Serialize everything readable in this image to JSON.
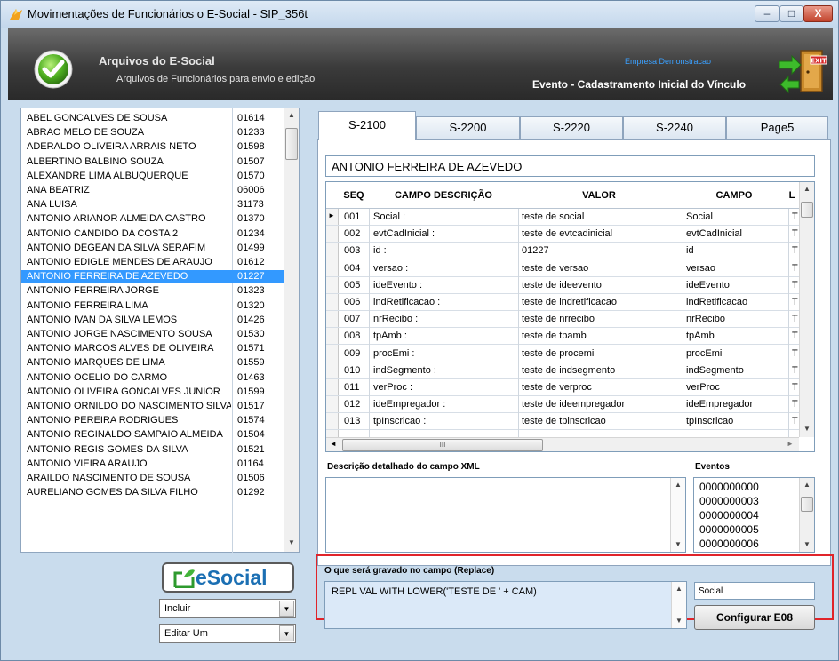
{
  "window": {
    "title": "Movimentações de Funcionários o E-Social - SIP_356t",
    "buttons": {
      "minimize": "–",
      "maximize": "□",
      "close": "X"
    }
  },
  "header": {
    "title": "Arquivos do E-Social",
    "subtitle": "Arquivos de Funcionários para envio e edição",
    "company": "Empresa Demonstracao",
    "event": "Evento - Cadastramento Inicial do Vínculo",
    "exit_label": "EXIT"
  },
  "employees": [
    {
      "name": "ABEL GONCALVES DE SOUSA",
      "code": "01614"
    },
    {
      "name": "ABRAO MELO DE SOUZA",
      "code": "01233"
    },
    {
      "name": "ADERALDO OLIVEIRA ARRAIS NETO",
      "code": "01598"
    },
    {
      "name": "ALBERTINO BALBINO SOUZA",
      "code": "01507"
    },
    {
      "name": "ALEXANDRE LIMA ALBUQUERQUE",
      "code": "01570"
    },
    {
      "name": "ANA BEATRIZ",
      "code": "06006"
    },
    {
      "name": "ANA LUISA",
      "code": "31173"
    },
    {
      "name": "ANTONIO ARIANOR ALMEIDA CASTRO",
      "code": "01370"
    },
    {
      "name": "ANTONIO CANDIDO DA COSTA 2",
      "code": "01234"
    },
    {
      "name": "ANTONIO DEGEAN DA SILVA SERAFIM",
      "code": "01499"
    },
    {
      "name": "ANTONIO EDIGLE MENDES DE ARAUJO",
      "code": "01612"
    },
    {
      "name": "ANTONIO FERREIRA DE AZEVEDO",
      "code": "01227"
    },
    {
      "name": "ANTONIO FERREIRA JORGE",
      "code": "01323"
    },
    {
      "name": "ANTONIO FERREIRA LIMA",
      "code": "01320"
    },
    {
      "name": "ANTONIO IVAN DA SILVA LEMOS",
      "code": "01426"
    },
    {
      "name": "ANTONIO JORGE NASCIMENTO SOUSA",
      "code": "01530"
    },
    {
      "name": "ANTONIO MARCOS ALVES DE OLIVEIRA",
      "code": "01571"
    },
    {
      "name": "ANTONIO MARQUES DE LIMA",
      "code": "01559"
    },
    {
      "name": "ANTONIO OCELIO DO CARMO",
      "code": "01463"
    },
    {
      "name": "ANTONIO OLIVEIRA GONCALVES JUNIOR",
      "code": "01599"
    },
    {
      "name": "ANTONIO ORNILDO DO NASCIMENTO SILVA",
      "code": "01517"
    },
    {
      "name": "ANTONIO PEREIRA RODRIGUES",
      "code": "01574"
    },
    {
      "name": "ANTONIO REGINALDO SAMPAIO ALMEIDA",
      "code": "01504"
    },
    {
      "name": "ANTONIO REGIS GOMES DA SILVA",
      "code": "01521"
    },
    {
      "name": "ANTONIO VIEIRA ARAUJO",
      "code": "01164"
    },
    {
      "name": "ARAILDO NASCIMENTO DE SOUSA",
      "code": "01506"
    },
    {
      "name": "AURELIANO GOMES DA SILVA FILHO",
      "code": "01292"
    }
  ],
  "selected_employee_index": 11,
  "logo": {
    "text": "eSocial"
  },
  "combos": {
    "action": "Incluir",
    "edit_mode": "Editar Um"
  },
  "tabs": [
    "S-2100",
    "S-2200",
    "S-2220",
    "S-2240",
    "Page5"
  ],
  "employee_name": "ANTONIO FERREIRA DE AZEVEDO",
  "grid": {
    "columns": [
      "SEQ",
      "CAMPO DESCRIÇÃO",
      "VALOR",
      "CAMPO",
      "L"
    ],
    "rows": [
      {
        "seq": "001",
        "desc": "Social :",
        "valor": "teste de social",
        "campo": "Social",
        "extra": "T"
      },
      {
        "seq": "002",
        "desc": "evtCadInicial :",
        "valor": "teste de evtcadinicial",
        "campo": "evtCadInicial",
        "extra": "T"
      },
      {
        "seq": "003",
        "desc": "id :",
        "valor": "01227",
        "campo": "id",
        "extra": "T"
      },
      {
        "seq": "004",
        "desc": "versao :",
        "valor": "teste de versao",
        "campo": "versao",
        "extra": "T"
      },
      {
        "seq": "005",
        "desc": "ideEvento :",
        "valor": "teste de ideevento",
        "campo": "ideEvento",
        "extra": "T"
      },
      {
        "seq": "006",
        "desc": "indRetificacao :",
        "valor": "teste de indretificacao",
        "campo": "indRetificacao",
        "extra": "T"
      },
      {
        "seq": "007",
        "desc": "nrRecibo :",
        "valor": "teste de nrrecibo",
        "campo": "nrRecibo",
        "extra": "T"
      },
      {
        "seq": "008",
        "desc": "tpAmb :",
        "valor": "teste de tpamb",
        "campo": "tpAmb",
        "extra": "T"
      },
      {
        "seq": "009",
        "desc": "procEmi :",
        "valor": "teste de procemi",
        "campo": "procEmi",
        "extra": "T"
      },
      {
        "seq": "010",
        "desc": "indSegmento :",
        "valor": "teste de indsegmento",
        "campo": "indSegmento",
        "extra": "T"
      },
      {
        "seq": "011",
        "desc": "verProc :",
        "valor": "teste de verproc",
        "campo": "verProc",
        "extra": "T"
      },
      {
        "seq": "012",
        "desc": "ideEmpregador :",
        "valor": "teste de ideempregador",
        "campo": "ideEmpregador",
        "extra": "T"
      },
      {
        "seq": "013",
        "desc": "tpInscricao :",
        "valor": "teste de tpinscricao",
        "campo": "tpInscricao",
        "extra": "T"
      }
    ]
  },
  "descricao_label": "Descrição detalhado do campo XML",
  "eventos": {
    "label": "Eventos",
    "items": [
      "0000000000",
      "0000000003",
      "0000000004",
      "0000000005",
      "0000000006"
    ]
  },
  "replace": {
    "label": "O que será gravado no campo (Replace)",
    "value": "REPL VAL WITH LOWER('TESTE DE ' + CAM)"
  },
  "campo_field": "Social",
  "config_button": "Configurar E08",
  "colors": {
    "selection": "#3399ff",
    "highlight": "#e0242a",
    "header_bg": "#3b3b3b"
  }
}
